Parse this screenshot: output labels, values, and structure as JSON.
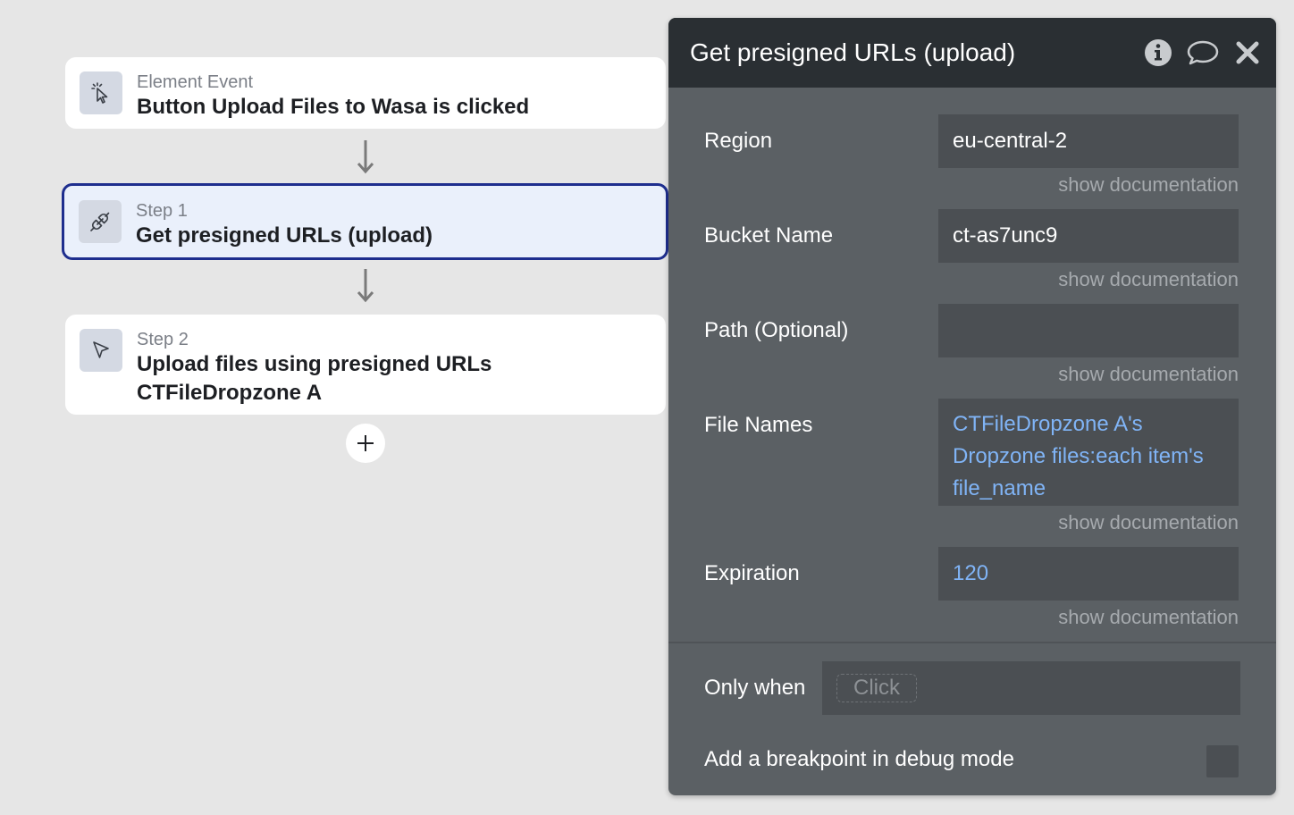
{
  "workflow": {
    "event": {
      "kicker": "Element Event",
      "title": "Button Upload Files to Wasa is clicked",
      "icon": "cursor-click-icon"
    },
    "step1": {
      "kicker": "Step 1",
      "title": "Get presigned URLs (upload)",
      "icon": "plug-icon"
    },
    "step2": {
      "kicker": "Step 2",
      "title_line1": "Upload files using presigned URLs",
      "title_line2": "CTFileDropzone A",
      "icon": "pointer-icon"
    }
  },
  "panel": {
    "title": "Get presigned URLs (upload)",
    "header_icons": [
      "info-icon",
      "comment-icon",
      "close-icon"
    ],
    "doc_link": "show documentation",
    "fields": {
      "region": {
        "label": "Region",
        "value": "eu-central-2"
      },
      "bucket": {
        "label": "Bucket Name",
        "value": "ct-as7unc9"
      },
      "path": {
        "label": "Path (Optional)",
        "value": ""
      },
      "file_names": {
        "label": "File Names",
        "line1": "CTFileDropzone A's",
        "line2": "Dropzone files:each item's",
        "line3": "file_name"
      },
      "expiration": {
        "label": "Expiration",
        "value": "120"
      }
    },
    "only_when": {
      "label": "Only when",
      "placeholder": "Click"
    },
    "breakpoint": {
      "label": "Add a breakpoint in debug mode",
      "checked": false
    }
  },
  "colors": {
    "selected_border": "#1e2e8e",
    "dynamic_text": "#80b4f6",
    "panel_bg": "#5b6064",
    "panel_header": "#2a2f33"
  }
}
